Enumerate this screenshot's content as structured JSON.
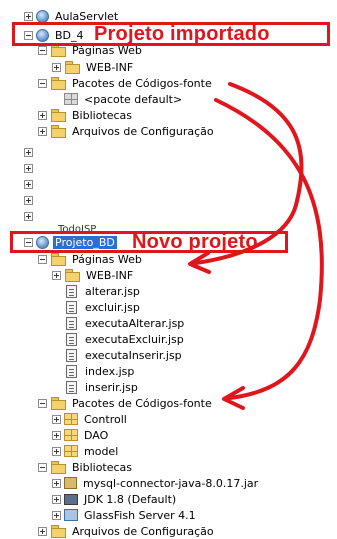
{
  "tree_top": [
    {
      "label": "AulaServlet",
      "icon": "globe-icon",
      "toggle": "collapsed"
    },
    {
      "label": "BD_4",
      "icon": "globe-icon",
      "toggle": "expanded"
    },
    {
      "label": "Páginas Web",
      "icon": "folder-icon",
      "toggle": "expanded"
    },
    {
      "label": "WEB-INF",
      "icon": "folder-icon",
      "toggle": "collapsed"
    },
    {
      "label": "Pacotes de Códigos-fonte",
      "icon": "folder-icon",
      "toggle": "expanded"
    },
    {
      "label": "<pacote default>",
      "icon": "package-icon",
      "toggle": "none"
    },
    {
      "label": "Bibliotecas",
      "icon": "folder-icon",
      "toggle": "collapsed"
    },
    {
      "label": "Arquivos de Configuração",
      "icon": "folder-icon",
      "toggle": "collapsed"
    }
  ],
  "tree_hidden_row": {
    "label": "TodoJSP"
  },
  "tree_bottom": [
    {
      "label": "Projeto_BD",
      "icon": "globe-icon",
      "toggle": "expanded",
      "selected": true
    },
    {
      "label": "Páginas Web",
      "icon": "folder-icon",
      "toggle": "expanded"
    },
    {
      "label": "WEB-INF",
      "icon": "folder-icon",
      "toggle": "collapsed"
    },
    {
      "label": "alterar.jsp",
      "icon": "file-icon",
      "toggle": "none"
    },
    {
      "label": "excluir.jsp",
      "icon": "file-icon",
      "toggle": "none"
    },
    {
      "label": "executaAlterar.jsp",
      "icon": "file-icon",
      "toggle": "none"
    },
    {
      "label": "executaExcluir.jsp",
      "icon": "file-icon",
      "toggle": "none"
    },
    {
      "label": "executaInserir.jsp",
      "icon": "file-icon",
      "toggle": "none"
    },
    {
      "label": "index.jsp",
      "icon": "file-icon",
      "toggle": "none"
    },
    {
      "label": "inserir.jsp",
      "icon": "file-icon",
      "toggle": "none"
    },
    {
      "label": "Pacotes de Códigos-fonte",
      "icon": "folder-icon",
      "toggle": "expanded"
    },
    {
      "label": "Controll",
      "icon": "package-icon",
      "toggle": "collapsed"
    },
    {
      "label": "DAO",
      "icon": "package-icon",
      "toggle": "collapsed"
    },
    {
      "label": "model",
      "icon": "package-icon",
      "toggle": "collapsed"
    },
    {
      "label": "Bibliotecas",
      "icon": "folder-icon",
      "toggle": "expanded"
    },
    {
      "label": "mysql-connector-java-8.0.17.jar",
      "icon": "jar-icon",
      "toggle": "collapsed"
    },
    {
      "label": "JDK 1.8 (Default)",
      "icon": "jdk-icon",
      "toggle": "collapsed"
    },
    {
      "label": "GlassFish Server 4.1",
      "icon": "server-icon",
      "toggle": "collapsed"
    },
    {
      "label": "Arquivos de Configuração",
      "icon": "folder-icon",
      "toggle": "collapsed"
    }
  ],
  "annotations": {
    "imported": "Projeto importado",
    "new_project": "Novo projeto"
  },
  "colors": {
    "annotation": "#e0161c",
    "selection": "#2b6fd6"
  }
}
